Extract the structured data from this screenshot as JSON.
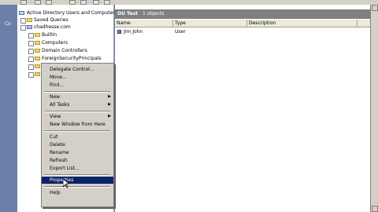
{
  "left_strip": {
    "label": "Co"
  },
  "tree": {
    "items": [
      {
        "label": "Active Directory Users and Computer"
      },
      {
        "label": "Saved Queries"
      },
      {
        "label": "chadhesse.com"
      },
      {
        "label": "Builtin"
      },
      {
        "label": "Computers"
      },
      {
        "label": "Domain Controllers"
      },
      {
        "label": "ForeignSecurityPrincipals"
      }
    ]
  },
  "content": {
    "header_title": "OU Test",
    "header_count": "1 objects",
    "columns": [
      "Name",
      "Type",
      "Description"
    ],
    "rows": [
      {
        "name": "Jim John",
        "type": "User",
        "description": ""
      }
    ]
  },
  "context_menu": {
    "items": [
      {
        "label": "Delegate Control..."
      },
      {
        "label": "Move..."
      },
      {
        "label": "Find..."
      },
      {
        "label": "New"
      },
      {
        "label": "All Tasks"
      },
      {
        "label": "View"
      },
      {
        "label": "New Window from Here"
      },
      {
        "label": "Cut"
      },
      {
        "label": "Delete"
      },
      {
        "label": "Rename"
      },
      {
        "label": "Refresh"
      },
      {
        "label": "Export List..."
      },
      {
        "label": "Properties"
      },
      {
        "label": "Help"
      }
    ],
    "submenu_arrow": "▶",
    "selected_color": "#0a246a"
  }
}
